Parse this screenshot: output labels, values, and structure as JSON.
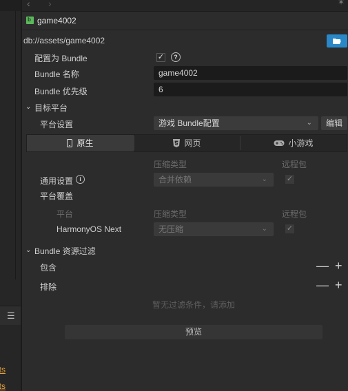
{
  "left_panel": {
    "asset_links": [
      "sets",
      "sets"
    ]
  },
  "topbar": {
    "back_icon": "chevron-left-icon",
    "forward_icon": "chevron-right-icon",
    "pin_icon": "pin-icon"
  },
  "header": {
    "title": "game4002",
    "path": "db://assets/game4002",
    "open_folder_icon": "folder-open-icon"
  },
  "bundle": {
    "configure_label": "配置为 Bundle",
    "configure_checked": true,
    "help_icon": "help-icon",
    "name_label": "Bundle 名称",
    "name_value": "game4002",
    "priority_label": "Bundle 优先级",
    "priority_value": "6"
  },
  "target_platform": {
    "section_label": "目标平台",
    "platform_settings_label": "平台设置",
    "platform_settings_value": "游戏 Bundle配置",
    "edit_button": "编辑",
    "tabs": [
      {
        "label": "原生",
        "icon": "phone-icon",
        "active": true
      },
      {
        "label": "网页",
        "icon": "html5-icon",
        "active": false
      },
      {
        "label": "小游戏",
        "icon": "gamepad-icon",
        "active": false
      }
    ],
    "columns": {
      "compression": "压缩类型",
      "remote": "远程包",
      "platform": "平台"
    },
    "general_settings_label": "通用设置",
    "general_info_icon": "info-icon",
    "general_compression": "合并依赖",
    "general_remote_checked": true,
    "override_label": "平台覆盖",
    "overrides": [
      {
        "platform": "HarmonyOS Next",
        "compression": "无压缩",
        "remote_checked": true
      }
    ]
  },
  "filter": {
    "section_label": "Bundle 资源过滤",
    "include_label": "包含",
    "exclude_label": "排除",
    "empty_text": "暂无过滤条件，请添加",
    "preview_button": "预览"
  }
}
